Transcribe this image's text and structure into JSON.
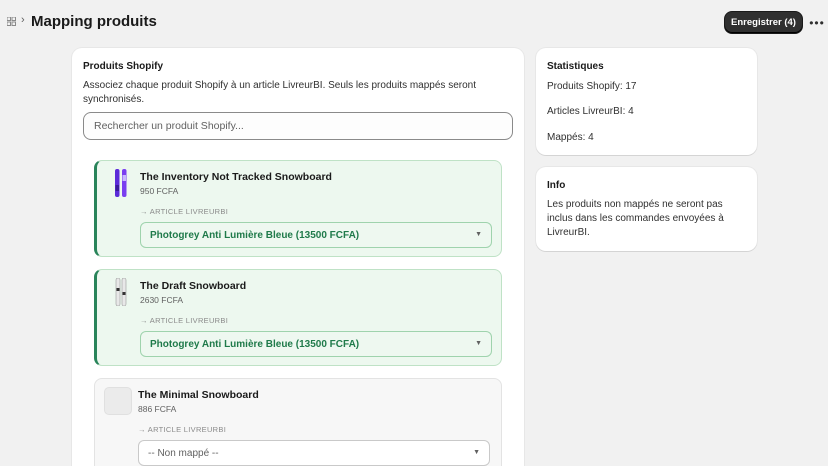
{
  "header": {
    "title": "Mapping produits",
    "save_label": "Enregistrer (4)",
    "more_label": "•••"
  },
  "main": {
    "title": "Produits Shopify",
    "description_line1": "Associez chaque produit Shopify à un article LivreurBI. Seuls les produits mappés seront",
    "description_line2": "synchronisés.",
    "search_placeholder": "Rechercher un produit Shopify...",
    "products": [
      {
        "name": "The Inventory Not Tracked Snowboard",
        "price": "950 FCFA",
        "label": "→ ARTICLE LIVREURBI",
        "selected": "Photogrey Anti Lumière Bleue (13500 FCFA)",
        "mapped": true
      },
      {
        "name": "The Draft Snowboard",
        "price": "2630 FCFA",
        "label": "→ ARTICLE LIVREURBI",
        "selected": "Photogrey Anti Lumière Bleue (13500 FCFA)",
        "mapped": true
      },
      {
        "name": "The Minimal Snowboard",
        "price": "886 FCFA",
        "label": "→ ARTICLE LIVREURBI",
        "selected": "-- Non mappé --",
        "mapped": false
      }
    ]
  },
  "stats": {
    "title": "Statistiques",
    "shopify": "Produits Shopify: 17",
    "articles": "Articles LivreurBI: 4",
    "mapped": "Mappés: 4"
  },
  "info": {
    "title": "Info",
    "line1": "Les produits non mappés ne seront pas",
    "line2": "inclus dans les commandes envoyées à",
    "line3": "LivreurBI."
  },
  "colors": {
    "mapped_accent": "#29845a",
    "mapped_bg": "#edf8ef",
    "primary_button": "#303030"
  }
}
